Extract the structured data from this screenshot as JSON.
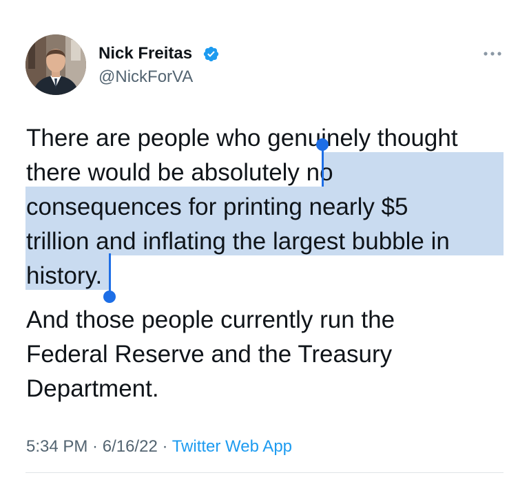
{
  "author": {
    "name": "Nick Freitas",
    "handle": "@NickForVA",
    "verified": true,
    "avatar_icon": "profile-photo"
  },
  "menu_icon": "more-horizontal-icon",
  "tweet": {
    "paragraph1": [
      "There are people who genuinely thought",
      "there would be absolutely no",
      "consequences for printing nearly $5",
      "trillion and inflating the largest bubble in",
      "history."
    ],
    "paragraph2": [
      "And those people currently run the",
      "Federal Reserve and the Treasury",
      "Department."
    ],
    "selected_text": "no consequences for printing nearly $5 trillion and inflating the largest bubble in history."
  },
  "meta": {
    "time": "5:34 PM",
    "separator": " · ",
    "date": "6/16/22",
    "source": "Twitter Web App"
  },
  "colors": {
    "selection": "#c9dbf0",
    "selection_handle": "#1d6ee6",
    "verified_badge": "#1d9bf0",
    "link": "#1d9bf0",
    "secondary_text": "#536471"
  }
}
